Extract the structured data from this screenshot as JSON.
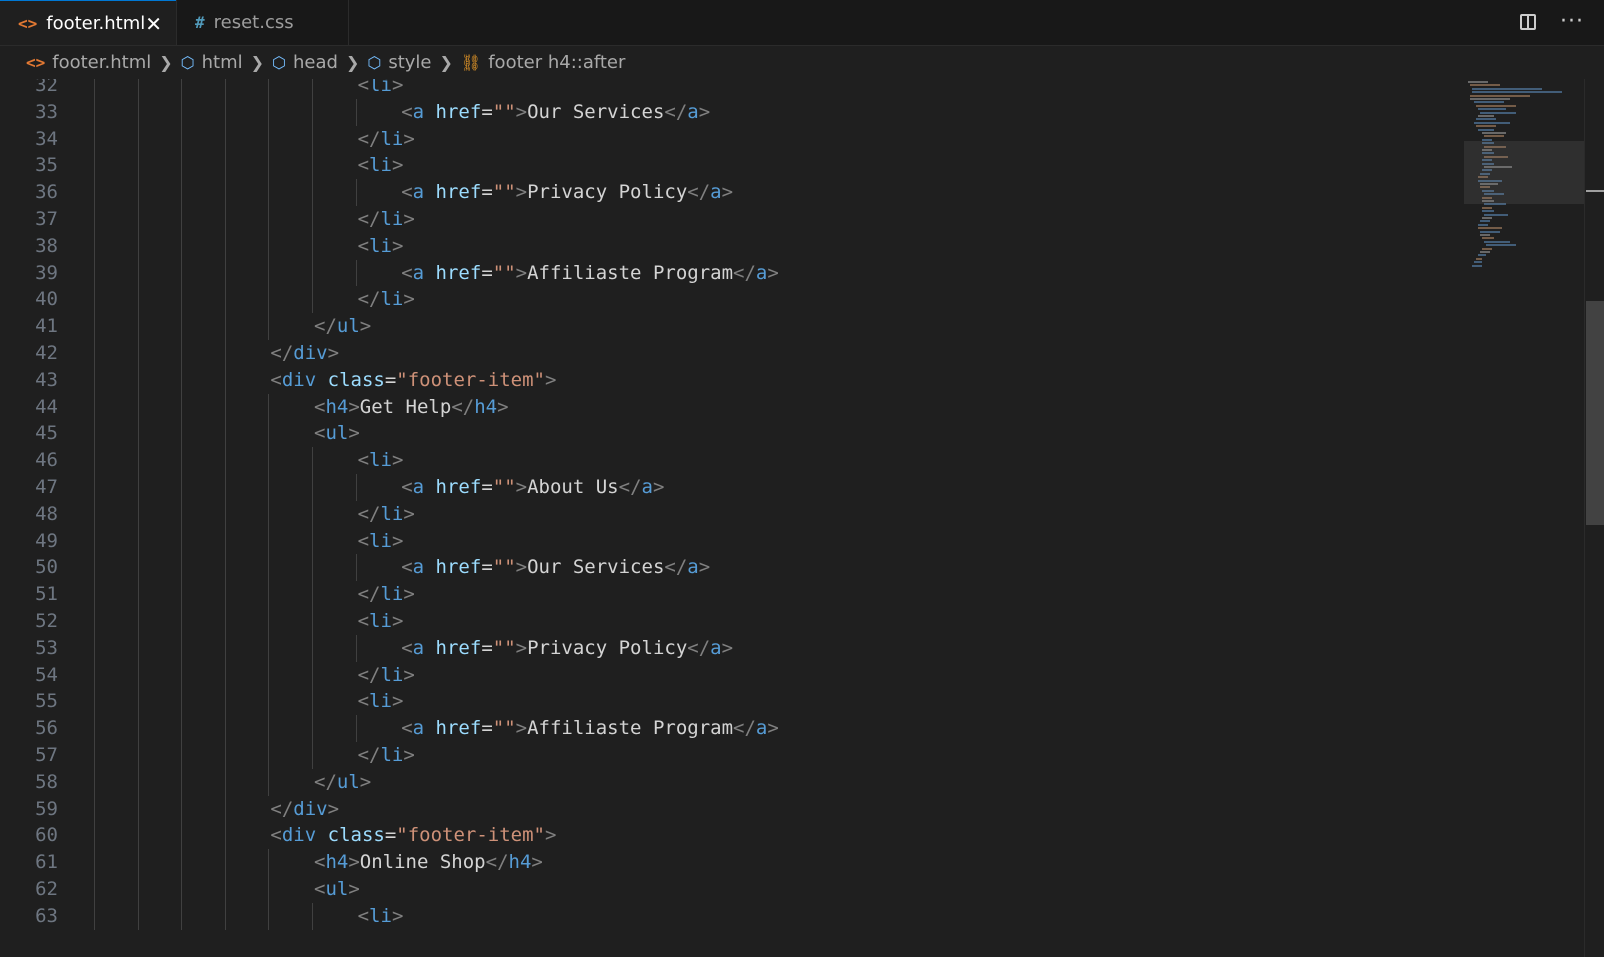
{
  "tabs": [
    {
      "icon": "<>",
      "label": "footer.html",
      "close": "✕"
    },
    {
      "icon": "#",
      "label": "reset.css"
    }
  ],
  "breadcrumb": {
    "file": "footer.html",
    "items": [
      "html",
      "head",
      "style",
      "footer h4::after"
    ]
  },
  "editor": {
    "lines": [
      {
        "n": "32",
        "indent": 6,
        "tokens": [
          [
            "t",
            "<"
          ],
          [
            "tn",
            "li"
          ],
          [
            "t",
            ">"
          ]
        ]
      },
      {
        "n": "33",
        "indent": 7,
        "tokens": [
          [
            "t",
            "<"
          ],
          [
            "tn",
            "a"
          ],
          [
            "tx",
            " "
          ],
          [
            "an",
            "href"
          ],
          [
            "tx",
            "="
          ],
          [
            "av",
            "\"\""
          ],
          [
            "t",
            ">"
          ],
          [
            "tx",
            "Our Services"
          ],
          [
            "t",
            "</"
          ],
          [
            "tn",
            "a"
          ],
          [
            "t",
            ">"
          ]
        ]
      },
      {
        "n": "34",
        "indent": 6,
        "tokens": [
          [
            "t",
            "</"
          ],
          [
            "tn",
            "li"
          ],
          [
            "t",
            ">"
          ]
        ]
      },
      {
        "n": "35",
        "indent": 6,
        "tokens": [
          [
            "t",
            "<"
          ],
          [
            "tn",
            "li"
          ],
          [
            "t",
            ">"
          ]
        ]
      },
      {
        "n": "36",
        "indent": 7,
        "tokens": [
          [
            "t",
            "<"
          ],
          [
            "tn",
            "a"
          ],
          [
            "tx",
            " "
          ],
          [
            "an",
            "href"
          ],
          [
            "tx",
            "="
          ],
          [
            "av",
            "\"\""
          ],
          [
            "t",
            ">"
          ],
          [
            "tx",
            "Privacy Policy"
          ],
          [
            "t",
            "</"
          ],
          [
            "tn",
            "a"
          ],
          [
            "t",
            ">"
          ]
        ]
      },
      {
        "n": "37",
        "indent": 6,
        "tokens": [
          [
            "t",
            "</"
          ],
          [
            "tn",
            "li"
          ],
          [
            "t",
            ">"
          ]
        ]
      },
      {
        "n": "38",
        "indent": 6,
        "tokens": [
          [
            "t",
            "<"
          ],
          [
            "tn",
            "li"
          ],
          [
            "t",
            ">"
          ]
        ]
      },
      {
        "n": "39",
        "indent": 7,
        "tokens": [
          [
            "t",
            "<"
          ],
          [
            "tn",
            "a"
          ],
          [
            "tx",
            " "
          ],
          [
            "an",
            "href"
          ],
          [
            "tx",
            "="
          ],
          [
            "av",
            "\"\""
          ],
          [
            "t",
            ">"
          ],
          [
            "tx",
            "Affiliaste Program"
          ],
          [
            "t",
            "</"
          ],
          [
            "tn",
            "a"
          ],
          [
            "t",
            ">"
          ]
        ]
      },
      {
        "n": "40",
        "indent": 6,
        "tokens": [
          [
            "t",
            "</"
          ],
          [
            "tn",
            "li"
          ],
          [
            "t",
            ">"
          ]
        ]
      },
      {
        "n": "41",
        "indent": 5,
        "tokens": [
          [
            "t",
            "</"
          ],
          [
            "tn",
            "ul"
          ],
          [
            "t",
            ">"
          ]
        ]
      },
      {
        "n": "42",
        "indent": 4,
        "tokens": [
          [
            "t",
            "</"
          ],
          [
            "tn",
            "div"
          ],
          [
            "t",
            ">"
          ]
        ]
      },
      {
        "n": "43",
        "indent": 4,
        "tokens": [
          [
            "t",
            "<"
          ],
          [
            "tn",
            "div"
          ],
          [
            "tx",
            " "
          ],
          [
            "an",
            "class"
          ],
          [
            "tx",
            "="
          ],
          [
            "av",
            "\"footer-item\""
          ],
          [
            "t",
            ">"
          ]
        ]
      },
      {
        "n": "44",
        "indent": 5,
        "tokens": [
          [
            "t",
            "<"
          ],
          [
            "tn",
            "h4"
          ],
          [
            "t",
            ">"
          ],
          [
            "tx",
            "Get Help"
          ],
          [
            "t",
            "</"
          ],
          [
            "tn",
            "h4"
          ],
          [
            "t",
            ">"
          ]
        ]
      },
      {
        "n": "45",
        "indent": 5,
        "tokens": [
          [
            "t",
            "<"
          ],
          [
            "tn",
            "ul"
          ],
          [
            "t",
            ">"
          ]
        ]
      },
      {
        "n": "46",
        "indent": 6,
        "tokens": [
          [
            "t",
            "<"
          ],
          [
            "tn",
            "li"
          ],
          [
            "t",
            ">"
          ]
        ]
      },
      {
        "n": "47",
        "indent": 7,
        "tokens": [
          [
            "t",
            "<"
          ],
          [
            "tn",
            "a"
          ],
          [
            "tx",
            " "
          ],
          [
            "an",
            "href"
          ],
          [
            "tx",
            "="
          ],
          [
            "av",
            "\"\""
          ],
          [
            "t",
            ">"
          ],
          [
            "tx",
            "About Us"
          ],
          [
            "t",
            "</"
          ],
          [
            "tn",
            "a"
          ],
          [
            "t",
            ">"
          ]
        ]
      },
      {
        "n": "48",
        "indent": 6,
        "tokens": [
          [
            "t",
            "</"
          ],
          [
            "tn",
            "li"
          ],
          [
            "t",
            ">"
          ]
        ]
      },
      {
        "n": "49",
        "indent": 6,
        "tokens": [
          [
            "t",
            "<"
          ],
          [
            "tn",
            "li"
          ],
          [
            "t",
            ">"
          ]
        ]
      },
      {
        "n": "50",
        "indent": 7,
        "tokens": [
          [
            "t",
            "<"
          ],
          [
            "tn",
            "a"
          ],
          [
            "tx",
            " "
          ],
          [
            "an",
            "href"
          ],
          [
            "tx",
            "="
          ],
          [
            "av",
            "\"\""
          ],
          [
            "t",
            ">"
          ],
          [
            "tx",
            "Our Services"
          ],
          [
            "t",
            "</"
          ],
          [
            "tn",
            "a"
          ],
          [
            "t",
            ">"
          ]
        ]
      },
      {
        "n": "51",
        "indent": 6,
        "tokens": [
          [
            "t",
            "</"
          ],
          [
            "tn",
            "li"
          ],
          [
            "t",
            ">"
          ]
        ]
      },
      {
        "n": "52",
        "indent": 6,
        "tokens": [
          [
            "t",
            "<"
          ],
          [
            "tn",
            "li"
          ],
          [
            "t",
            ">"
          ]
        ]
      },
      {
        "n": "53",
        "indent": 7,
        "tokens": [
          [
            "t",
            "<"
          ],
          [
            "tn",
            "a"
          ],
          [
            "tx",
            " "
          ],
          [
            "an",
            "href"
          ],
          [
            "tx",
            "="
          ],
          [
            "av",
            "\"\""
          ],
          [
            "t",
            ">"
          ],
          [
            "tx",
            "Privacy Policy"
          ],
          [
            "t",
            "</"
          ],
          [
            "tn",
            "a"
          ],
          [
            "t",
            ">"
          ]
        ]
      },
      {
        "n": "54",
        "indent": 6,
        "tokens": [
          [
            "t",
            "</"
          ],
          [
            "tn",
            "li"
          ],
          [
            "t",
            ">"
          ]
        ]
      },
      {
        "n": "55",
        "indent": 6,
        "tokens": [
          [
            "t",
            "<"
          ],
          [
            "tn",
            "li"
          ],
          [
            "t",
            ">"
          ]
        ]
      },
      {
        "n": "56",
        "indent": 7,
        "tokens": [
          [
            "t",
            "<"
          ],
          [
            "tn",
            "a"
          ],
          [
            "tx",
            " "
          ],
          [
            "an",
            "href"
          ],
          [
            "tx",
            "="
          ],
          [
            "av",
            "\"\""
          ],
          [
            "t",
            ">"
          ],
          [
            "tx",
            "Affiliaste Program"
          ],
          [
            "t",
            "</"
          ],
          [
            "tn",
            "a"
          ],
          [
            "t",
            ">"
          ]
        ]
      },
      {
        "n": "57",
        "indent": 6,
        "tokens": [
          [
            "t",
            "</"
          ],
          [
            "tn",
            "li"
          ],
          [
            "t",
            ">"
          ]
        ]
      },
      {
        "n": "58",
        "indent": 5,
        "tokens": [
          [
            "t",
            "</"
          ],
          [
            "tn",
            "ul"
          ],
          [
            "t",
            ">"
          ]
        ]
      },
      {
        "n": "59",
        "indent": 4,
        "tokens": [
          [
            "t",
            "</"
          ],
          [
            "tn",
            "div"
          ],
          [
            "t",
            ">"
          ]
        ]
      },
      {
        "n": "60",
        "indent": 4,
        "tokens": [
          [
            "t",
            "<"
          ],
          [
            "tn",
            "div"
          ],
          [
            "tx",
            " "
          ],
          [
            "an",
            "class"
          ],
          [
            "tx",
            "="
          ],
          [
            "av",
            "\"footer-item\""
          ],
          [
            "t",
            ">"
          ]
        ]
      },
      {
        "n": "61",
        "indent": 5,
        "tokens": [
          [
            "t",
            "<"
          ],
          [
            "tn",
            "h4"
          ],
          [
            "t",
            ">"
          ],
          [
            "tx",
            "Online Shop"
          ],
          [
            "t",
            "</"
          ],
          [
            "tn",
            "h4"
          ],
          [
            "t",
            ">"
          ]
        ]
      },
      {
        "n": "62",
        "indent": 5,
        "tokens": [
          [
            "t",
            "<"
          ],
          [
            "tn",
            "ul"
          ],
          [
            "t",
            ">"
          ]
        ]
      },
      {
        "n": "63",
        "indent": 6,
        "tokens": [
          [
            "t",
            "<"
          ],
          [
            "tn",
            "li"
          ],
          [
            "t",
            ">"
          ]
        ]
      }
    ]
  },
  "colors": {
    "background": "#1f1f1f",
    "tag_bracket": "#808080",
    "tag_name": "#569cd6",
    "attr_name": "#9cdcfe",
    "attr_value": "#ce9178",
    "text": "#d4d4d4",
    "line_number": "#6e7681",
    "html_icon": "#e37933",
    "symbol_icon": "#75beff",
    "selector_icon": "#ee9d28"
  }
}
